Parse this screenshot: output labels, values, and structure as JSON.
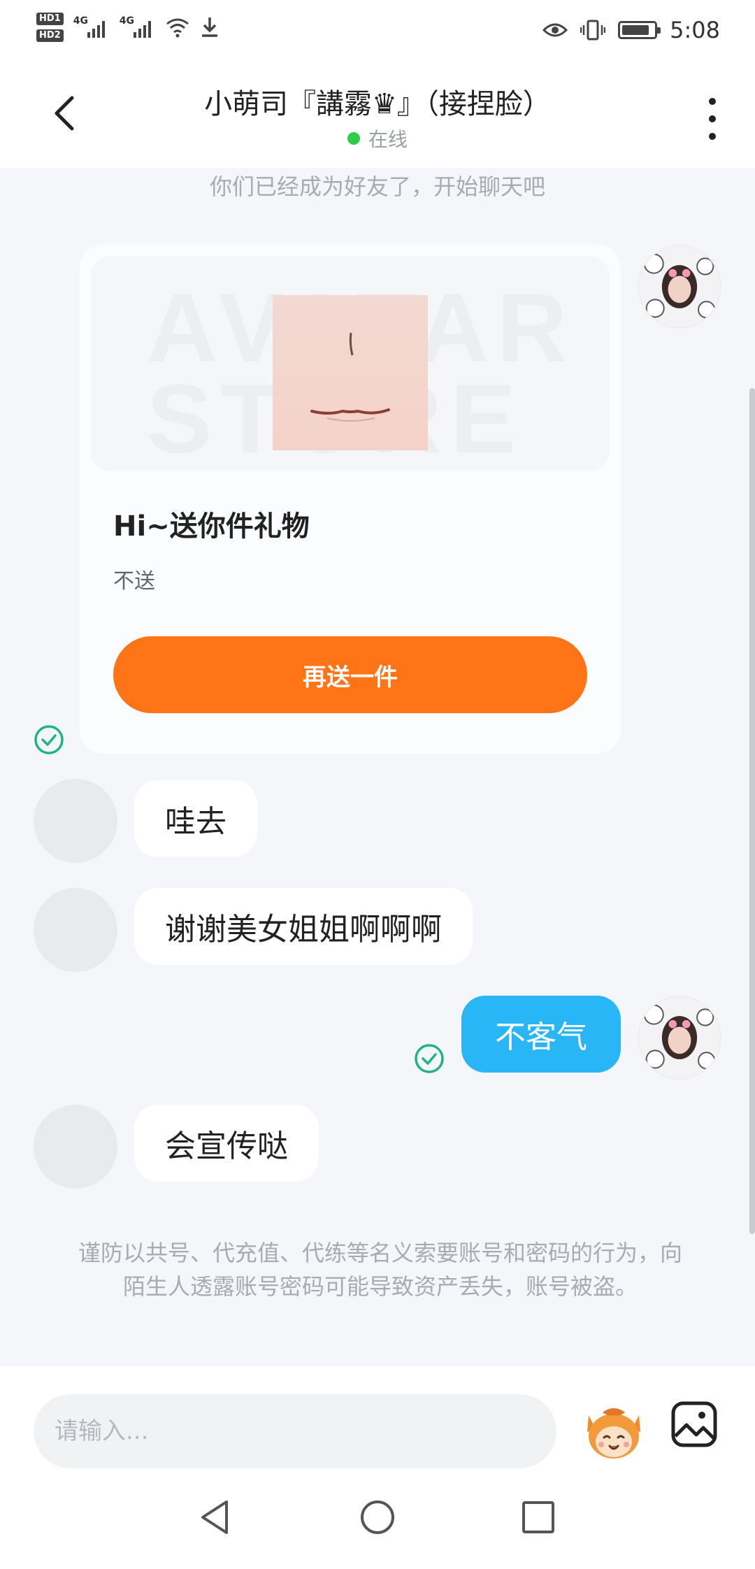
{
  "status_bar": {
    "hd_labels": [
      "HD1",
      "HD2"
    ],
    "network_1": "4G",
    "network_2": "4G",
    "time": "5:08"
  },
  "header": {
    "title": "小萌司『講霧♛』（接捏脸）",
    "status": "在线"
  },
  "chat": {
    "system_note": "你们已经成为好友了，开始聊天吧",
    "gift_card": {
      "watermark": "AVATAR STORE",
      "title": "Hi~送你件礼物",
      "subtitle": "不送",
      "button_label": "再送一件"
    },
    "messages": [
      {
        "from": "other",
        "text": "哇去"
      },
      {
        "from": "other",
        "text": "谢谢美女姐姐啊啊啊"
      },
      {
        "from": "self",
        "text": "不客气"
      },
      {
        "from": "other",
        "text": "会宣传哒"
      }
    ],
    "warning": "谨防以共号、代充值、代练等名义索要账号和密码的行为，向陌生人透露账号密码可能导致资产丢失，账号被盗。"
  },
  "input": {
    "placeholder": "请输入..."
  },
  "colors": {
    "accent_orange": "#ff7417",
    "self_bubble": "#29b6f6",
    "online_dot": "#2ecc4a",
    "read_check": "#1fb580"
  },
  "icons": [
    "back-icon",
    "more-icon",
    "check-icon",
    "mascot-icon",
    "image-icon",
    "nav-back-icon",
    "nav-home-icon",
    "nav-recent-icon"
  ]
}
